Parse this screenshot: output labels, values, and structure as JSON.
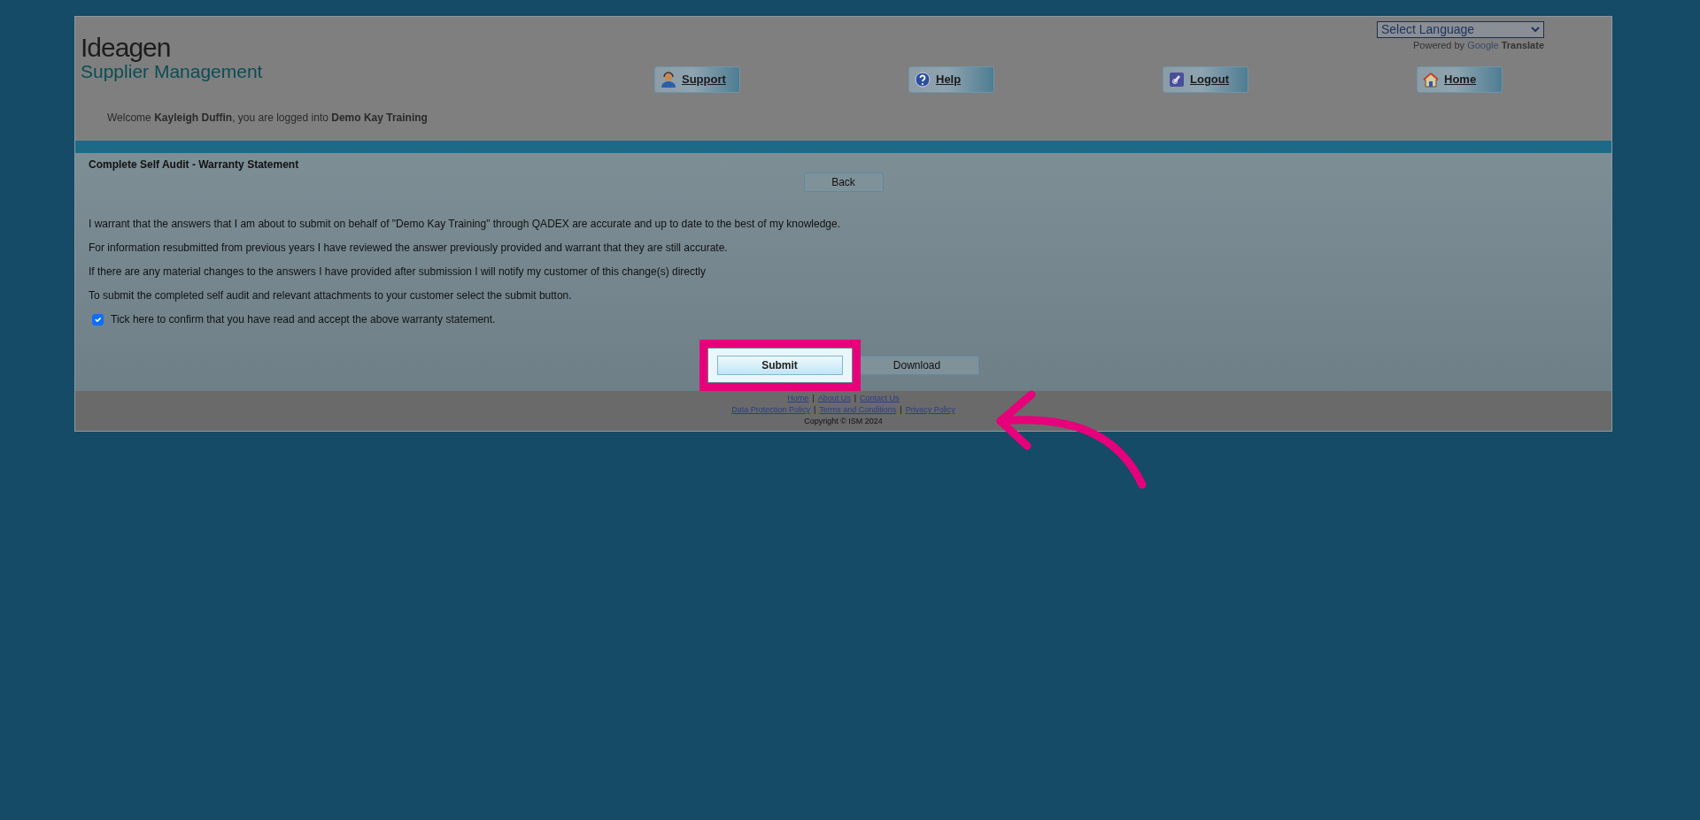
{
  "language_select": {
    "value": "Select Language"
  },
  "translate_credit": {
    "prefix": "Powered by",
    "brand": "Google",
    "suffix": "Translate"
  },
  "logo": {
    "name": "Ideagen",
    "subtitle": "Supplier Management"
  },
  "nav": [
    {
      "label": "Support",
      "kind": "support"
    },
    {
      "label": "Help",
      "kind": "help"
    },
    {
      "label": "Logout",
      "kind": "logout"
    },
    {
      "label": "Home",
      "kind": "home"
    }
  ],
  "welcome": "Welcome **Kayleigh Duffin**, you are logged into **Demo Kay Training**",
  "page_title": "Complete Self Audit  - Warranty Statement",
  "back_button": "Back",
  "statements": [
    "I warrant that the answers that I am about to submit on behalf of \"Demo Kay Training\" through QADEX are accurate and up to date to the best of my knowledge.",
    "For information resubmitted from previous years I have reviewed the answer previously provided and warrant that they are still accurate.",
    "If there are any material changes to the answers I have provided after submission I will notify my customer of this change(s) directly",
    "To submit the completed self audit and relevant attachments to your customer select the submit button."
  ],
  "confirm": {
    "label": "Tick here to confirm that you have read and accept the above warranty statement.",
    "checked": true
  },
  "actions": [
    {
      "label": "Submit",
      "highlighted": true
    },
    {
      "label": "Download",
      "highlighted": false
    }
  ],
  "footer": {
    "separator": "|",
    "link_rows": [
      [
        "Home",
        "About Us",
        "Contact Us"
      ],
      [
        "Data Protection Policy",
        "Terms and Conditions",
        "Privacy Policy"
      ]
    ],
    "copyright": "Copyright © ISM 2024"
  }
}
